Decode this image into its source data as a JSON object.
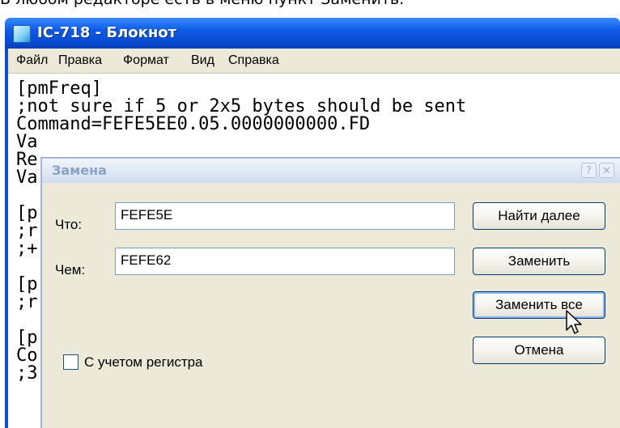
{
  "caption": "В любом редакторе есть в меню пункт Заменить.",
  "notepad": {
    "title": "IC-718 - Блокнот",
    "menu": [
      "Файл",
      "Правка",
      "Формат",
      "Вид",
      "Справка"
    ],
    "lines": [
      "[pmFreq]",
      ";not sure if 5 or 2x5 bytes should be sent",
      "Command=FEFE5EE0.05.0000000000.FD",
      "Va",
      "Re",
      "Va",
      "",
      "[p",
      ";r",
      ";+",
      "",
      "[p",
      ";r",
      "",
      "[p",
      "Co",
      ";3"
    ]
  },
  "dialog": {
    "title": "Замена",
    "help_glyph": "?",
    "close_glyph": "✕",
    "find_label": "Что:",
    "find_value": "FEFE5E",
    "replace_label": "Чем:",
    "replace_value": "FEFE62",
    "match_case_label": "С учетом регистра",
    "match_case_checked": false,
    "buttons": {
      "find_next": "Найти далее",
      "replace": "Заменить",
      "replace_all": "Заменить все",
      "cancel": "Отмена"
    }
  },
  "icons": {
    "app": "notepad-icon",
    "help": "help-icon",
    "close": "close-icon",
    "cursor": "mouse-pointer-icon"
  }
}
